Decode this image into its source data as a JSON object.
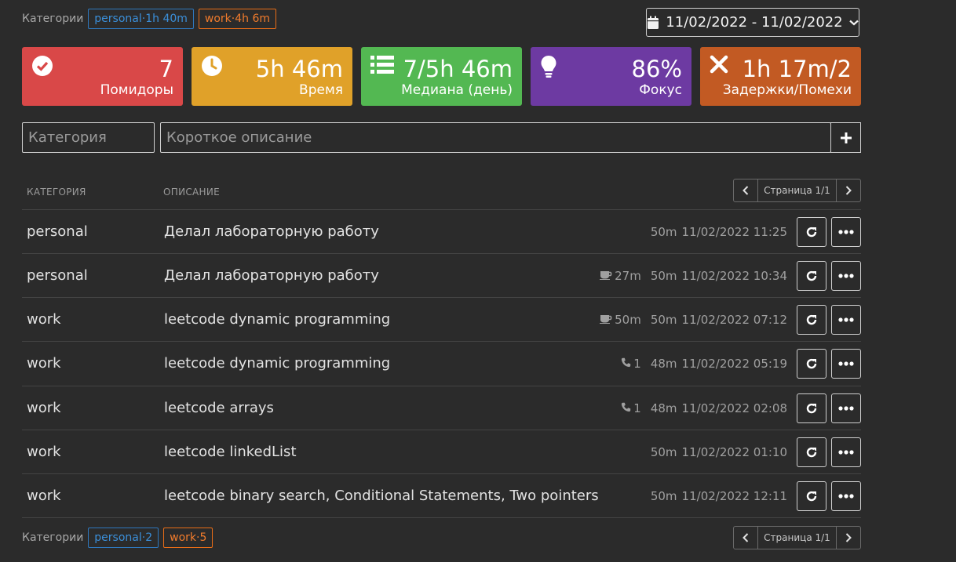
{
  "top_categories": {
    "label": "Категории",
    "tags": [
      {
        "name": "personal",
        "sep": "·",
        "value": "1h 40m",
        "color": "#3b8fd9"
      },
      {
        "name": "work",
        "sep": "·",
        "value": "4h 6m",
        "color": "#f07b2c"
      }
    ]
  },
  "date_range": {
    "value": "11/02/2022 - 11/02/2022",
    "icon": "calendar-icon"
  },
  "stats": [
    {
      "value": "7",
      "caption": "Помидоры",
      "icon": "check-circle-icon",
      "color": "#d94848"
    },
    {
      "value": "5h 46m",
      "caption": "Время",
      "icon": "clock-icon",
      "color": "#e0a129"
    },
    {
      "value": "7/5h 46m",
      "caption": "Медиана (день)",
      "icon": "list-icon",
      "color": "#53b852"
    },
    {
      "value": "86%",
      "caption": "Фокус",
      "icon": "lightbulb-icon",
      "color": "#6d3aa2"
    },
    {
      "value": "1h 17m/2",
      "caption": "Задержки/Помехи",
      "icon": "x-icon",
      "color": "#c25a23"
    }
  ],
  "form": {
    "category_placeholder": "Категория",
    "description_placeholder": "Короткое описание",
    "add_icon": "plus-icon"
  },
  "table": {
    "headers": {
      "category": "КАТЕГОРИЯ",
      "description": "ОПИСАНИЕ"
    },
    "pager": {
      "label": "Страница 1/1"
    },
    "rows": [
      {
        "category": "personal",
        "description": "Делал лабораторную работу",
        "extra_icon": "",
        "extra_value": "",
        "duration": "50m",
        "datetime": "11/02/2022 11:25"
      },
      {
        "category": "personal",
        "description": "Делал лабораторную работу",
        "extra_icon": "coffee-icon",
        "extra_value": "27m",
        "duration": "50m",
        "datetime": "11/02/2022 10:34"
      },
      {
        "category": "work",
        "description": "leetcode dynamic programming",
        "extra_icon": "coffee-icon",
        "extra_value": "50m",
        "duration": "50m",
        "datetime": "11/02/2022 07:12"
      },
      {
        "category": "work",
        "description": "leetcode dynamic programming",
        "extra_icon": "phone-icon",
        "extra_value": "1",
        "duration": "48m",
        "datetime": "11/02/2022 05:19"
      },
      {
        "category": "work",
        "description": "leetcode arrays",
        "extra_icon": "phone-icon",
        "extra_value": "1",
        "duration": "48m",
        "datetime": "11/02/2022 02:08"
      },
      {
        "category": "work",
        "description": "leetcode linkedList",
        "extra_icon": "",
        "extra_value": "",
        "duration": "50m",
        "datetime": "11/02/2022 01:10"
      },
      {
        "category": "work",
        "description": "leetcode binary search, Conditional Statements, Two pointers",
        "extra_icon": "",
        "extra_value": "",
        "duration": "50m",
        "datetime": "11/02/2022 12:11"
      }
    ]
  },
  "bottom_categories": {
    "label": "Категории",
    "tags": [
      {
        "name": "personal",
        "sep": "·",
        "value": "2",
        "color": "#3b8fd9"
      },
      {
        "name": "work",
        "sep": "·",
        "value": "5",
        "color": "#f07b2c"
      }
    ]
  },
  "bottom_pager": {
    "label": "Страница 1/1"
  }
}
